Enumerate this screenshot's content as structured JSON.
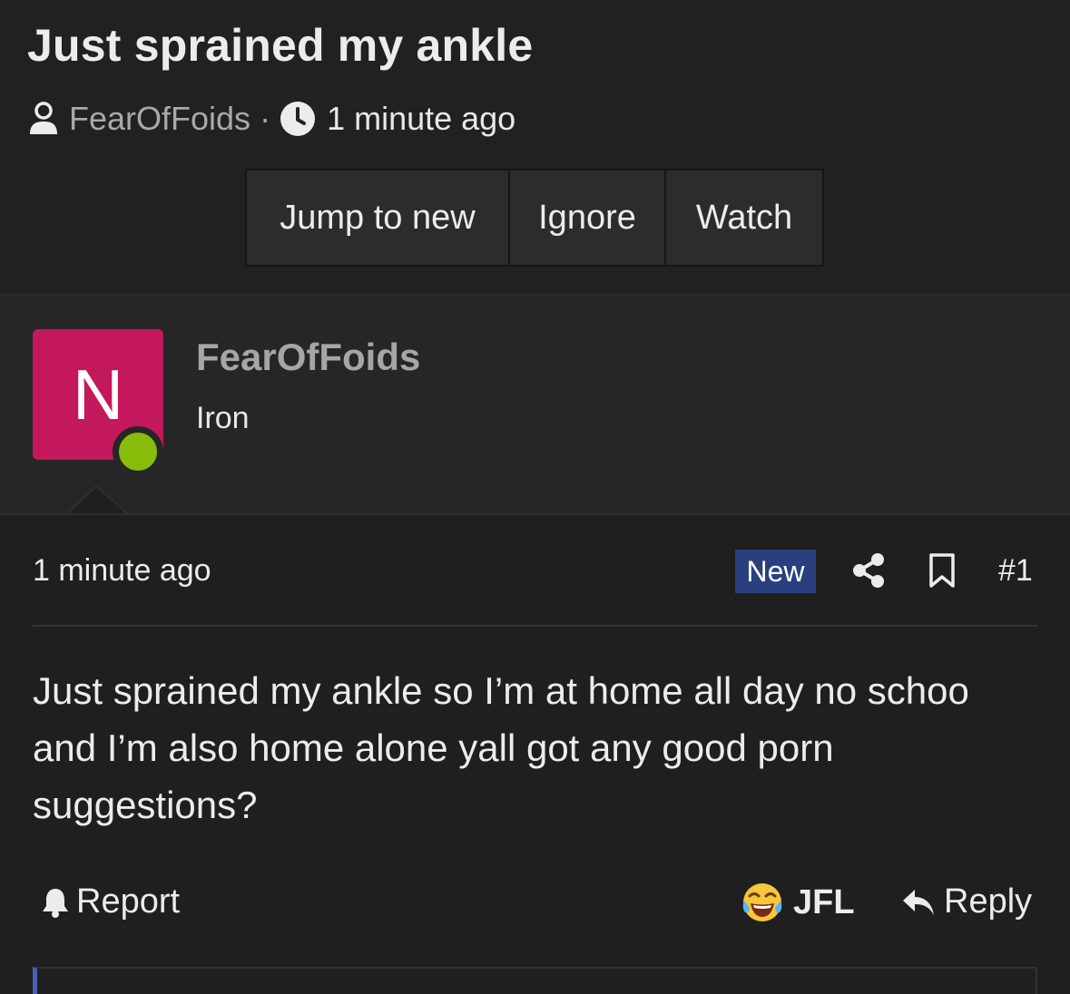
{
  "thread": {
    "title": "Just sprained my ankle",
    "author": "FearOfFoids",
    "separator": "·",
    "time": "1 minute ago"
  },
  "actions": {
    "jump_to_new": "Jump to new",
    "ignore": "Ignore",
    "watch": "Watch"
  },
  "user": {
    "avatar_letter": "N",
    "avatar_color": "#c4185c",
    "online_color": "#87bc0b",
    "username": "FearOfFoids",
    "rank": "Iron"
  },
  "post": {
    "time": "1 minute ago",
    "new_badge": "New",
    "number": "#1",
    "body": "Just sprained my ankle so I’m at home all day no schoo and I’m also home alone yall got any good porn suggestions?"
  },
  "footer": {
    "report": "Report",
    "reaction": "JFL",
    "reply": "Reply"
  },
  "icons": {
    "user": "user-icon",
    "clock": "clock-icon",
    "share": "share-icon",
    "bookmark": "bookmark-icon",
    "bell": "bell-icon",
    "emoji": "tears-of-joy-emoji-icon",
    "reply": "reply-arrow-icon"
  }
}
